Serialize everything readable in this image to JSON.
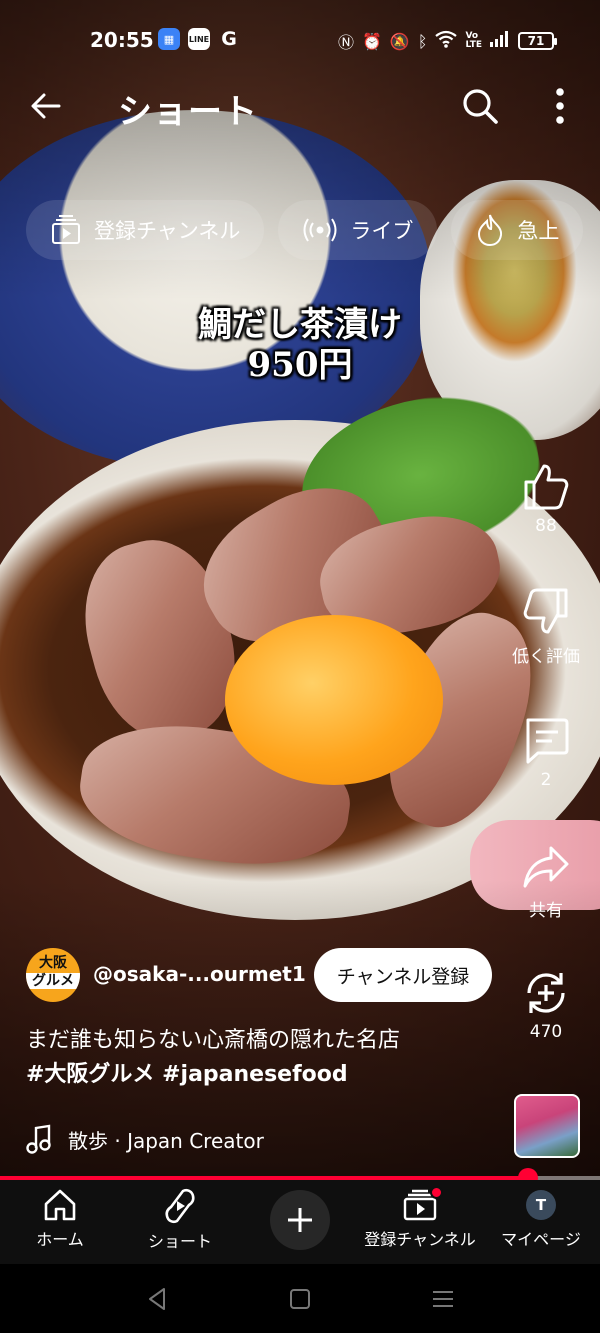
{
  "status_bar": {
    "time": "20:55",
    "app_icons": [
      {
        "name": "calendar-app-icon",
        "label": "",
        "color": "#3b82f6"
      },
      {
        "name": "line-app-icon",
        "label": "LINE",
        "color": "#ffffff"
      },
      {
        "name": "google-app-icon",
        "label": "G",
        "color": "#ffffff"
      }
    ],
    "battery": "71"
  },
  "header": {
    "title": "ショート"
  },
  "chips": [
    {
      "label": "登録チャンネル",
      "icon": "subscriptions-icon"
    },
    {
      "label": "ライブ",
      "icon": "live-icon"
    },
    {
      "label": "急上",
      "icon": "trending-icon"
    }
  ],
  "caption": {
    "line1": "鯛だし茶漬け",
    "line2": "950円"
  },
  "actions": {
    "like_count": "88",
    "dislike_label": "低く評価",
    "comment_count": "2",
    "share_label": "共有",
    "remix_count": "470"
  },
  "channel": {
    "avatar_top": "大阪",
    "avatar_bottom": "グルメ",
    "handle": "@osaka-...ourmet1",
    "subscribe_label": "チャンネル登録"
  },
  "description": {
    "text": "まだ誰も知らない心斎橋の隠れた名店",
    "hashtags": "#大阪グルメ #japanesefood"
  },
  "music": {
    "label": "散歩 · Japan Creator"
  },
  "progress": {
    "fraction": 0.88
  },
  "bottom_nav": {
    "home": "ホーム",
    "shorts": "ショート",
    "subscriptions": "登録チャンネル",
    "my_page": "マイページ",
    "profile_initial": "T"
  },
  "colors": {
    "accent": "#ff0033",
    "nav_bg": "#0f0f0f"
  }
}
